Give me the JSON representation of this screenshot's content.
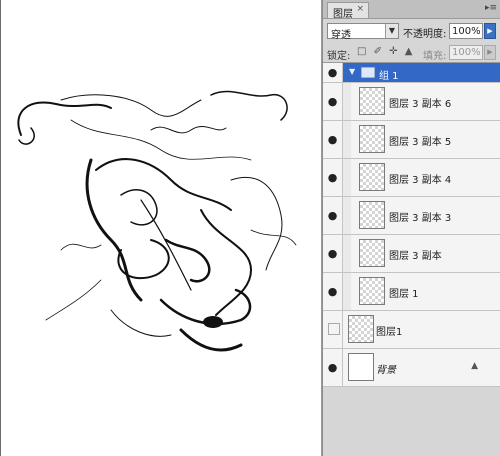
{
  "panel": {
    "tab_label": "图层",
    "tab_close": "×",
    "menu_icon": "▸≡",
    "blend_mode": "穿透",
    "opacity_label": "不透明度:",
    "opacity_value": "100%",
    "lock_label": "锁定:",
    "lock_icons": "□ ✐ ✛ ▲",
    "fill_label": "填充:",
    "fill_value": "100%"
  },
  "layers": [
    {
      "type": "group",
      "name": "组 1",
      "visible": true,
      "selected": true
    },
    {
      "type": "layer",
      "name": "图层 3 副本 6",
      "visible": true,
      "indent": true
    },
    {
      "type": "layer",
      "name": "图层 3 副本 5",
      "visible": true,
      "indent": true
    },
    {
      "type": "layer",
      "name": "图层 3 副本 4",
      "visible": true,
      "indent": true
    },
    {
      "type": "layer",
      "name": "图层 3 副本 3",
      "visible": true,
      "indent": true
    },
    {
      "type": "layer",
      "name": "图层 3 副本",
      "visible": true,
      "indent": true
    },
    {
      "type": "layer",
      "name": "图层 1",
      "visible": true,
      "indent": true
    },
    {
      "type": "layer",
      "name": "图层1",
      "visible": false,
      "indent": false
    },
    {
      "type": "background",
      "name": "背景",
      "visible": true,
      "indent": false,
      "locked": true
    }
  ],
  "colors": {
    "selection": "#3468c6",
    "panel_bg": "#d6d6d6"
  }
}
